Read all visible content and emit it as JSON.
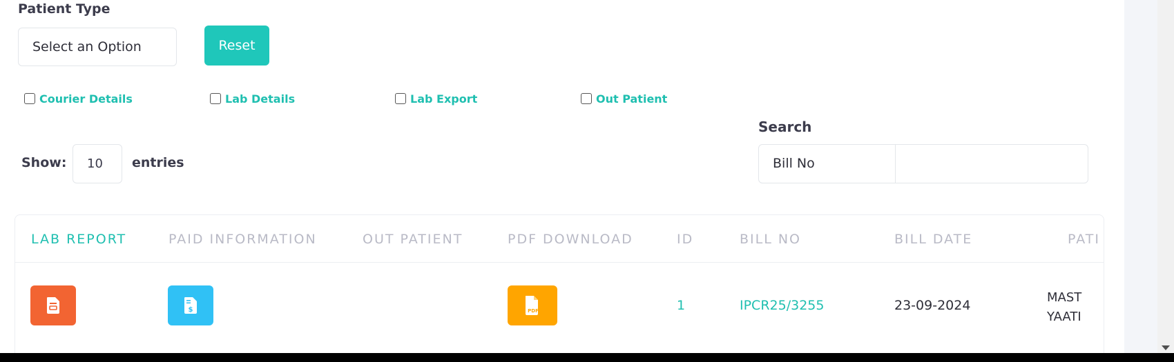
{
  "filters": {
    "patient_type_label": "Patient Type",
    "patient_type_value": "Select an Option",
    "reset_label": "Reset",
    "checkboxes": [
      "Courier Details",
      "Lab Details",
      "Lab Export",
      "Out Patient"
    ]
  },
  "length": {
    "show_label": "Show:",
    "value": "10",
    "entries_label": "entries"
  },
  "search": {
    "label": "Search",
    "field_value": "Bill No",
    "input_value": ""
  },
  "table": {
    "headers": [
      "LAB REPORT",
      "PAID INFORMATION",
      "OUT PATIENT",
      "PDF DOWNLOAD",
      "ID",
      "BILL NO",
      "BILL DATE",
      "PATI"
    ],
    "row": {
      "id": "1",
      "bill_no": "IPCR25/3255",
      "bill_date": "23-09-2024",
      "patient_line1": "MAST",
      "patient_line2": "YAATI",
      "pdf_text": "PDF"
    }
  },
  "colors": {
    "accent": "#1fc7ba",
    "lab_report_btn": "#f26432",
    "paid_info_btn": "#30c1f5",
    "pdf_btn": "#ffa500"
  },
  "icons": {
    "lab_report": "document-icon",
    "paid_info": "invoice-dollar-icon",
    "pdf": "pdf-file-icon",
    "scroll": "scroll-down-arrow-icon"
  }
}
